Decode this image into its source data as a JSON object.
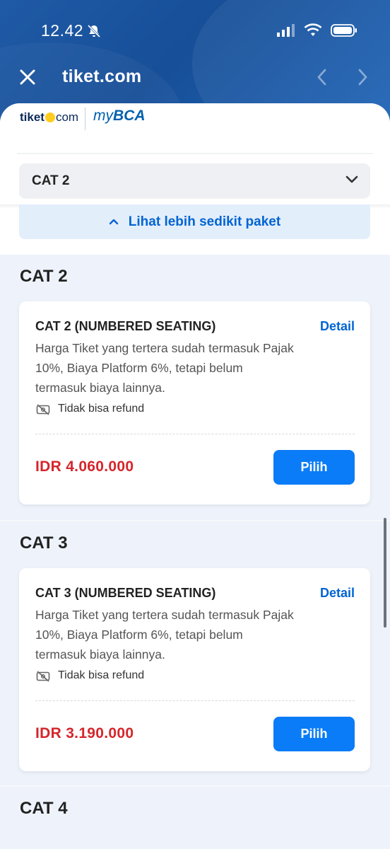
{
  "status": {
    "time": "12.42"
  },
  "nav": {
    "title": "tiket.com"
  },
  "brand": {
    "tiket_left": "tiket",
    "tiket_right": "com",
    "bca_prefix": "my",
    "bca_suffix": "BCA"
  },
  "dropdown": {
    "selected": "CAT 2"
  },
  "toggle": {
    "label": "Lihat lebih sedikit paket"
  },
  "sections": [
    {
      "title": "CAT 2",
      "card": {
        "name": "CAT 2 (NUMBERED SEATING)",
        "detail": "Detail",
        "description": "Harga Tiket yang tertera sudah termasuk Pajak 10%, Biaya Platform 6%, tetapi belum termasuk biaya lainnya.",
        "refund": "Tidak bisa refund",
        "price": "IDR 4.060.000",
        "button": "Pilih"
      }
    },
    {
      "title": "CAT 3",
      "card": {
        "name": "CAT 3 (NUMBERED SEATING)",
        "detail": "Detail",
        "description": "Harga Tiket yang tertera sudah termasuk Pajak 10%, Biaya Platform 6%, tetapi belum termasuk biaya lainnya.",
        "refund": "Tidak bisa refund",
        "price": "IDR 3.190.000",
        "button": "Pilih"
      }
    },
    {
      "title": "CAT 4"
    }
  ],
  "colors": {
    "header": "#1f5aa6",
    "accent": "#0064d2",
    "price": "#d4262c",
    "button": "#0a7cf7"
  }
}
